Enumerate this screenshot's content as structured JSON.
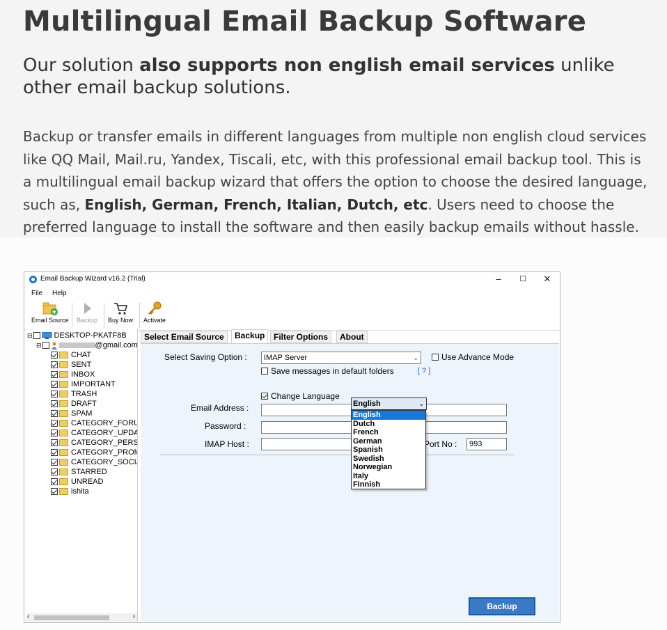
{
  "page": {
    "title": "Multilingual Email Backup Software",
    "subtitle_pre": "Our solution ",
    "subtitle_bold": "also supports non english email services",
    "subtitle_post": " unlike other email backup solutions.",
    "para_pre": "Backup or transfer emails in different languages from multiple non english cloud services like QQ Mail, Mail.ru, Yandex, Tiscali, etc, with this professional email backup tool. This is a multilingual email backup wizard that offers the option to choose the desired language, such as, ",
    "para_bold": "English, German, French, Italian, Dutch, etc",
    "para_post": ". Users need to choose the preferred language to install the software and then easily backup emails without hassle."
  },
  "window": {
    "title": "Email Backup Wizard v16.2 (Trial)",
    "controls": {
      "minimize": "–",
      "maximize": "☐",
      "close": "✕"
    },
    "menu": [
      "File",
      "Help"
    ],
    "toolbar": [
      "Email Source",
      "Backup",
      "Buy Now",
      "Activate"
    ],
    "tree": {
      "root": "DESKTOP-PKATF8B",
      "account": "@gmail.com",
      "folders": [
        "CHAT",
        "SENT",
        "INBOX",
        "IMPORTANT",
        "TRASH",
        "DRAFT",
        "SPAM",
        "CATEGORY_FORUMS",
        "CATEGORY_UPDATES",
        "CATEGORY_PERSONAL",
        "CATEGORY_PROMOTIONS",
        "CATEGORY_SOCIAL",
        "STARRED",
        "UNREAD",
        "ishita"
      ]
    },
    "tabs": [
      "Select Email Source",
      "Backup",
      "Filter Options",
      "About"
    ],
    "active_tab": "Backup",
    "form": {
      "saving_label": "Select Saving Option :",
      "saving_value": "IMAP Server",
      "advance_mode": "Use Advance Mode",
      "default_folders": "Save messages in default folders",
      "help_link": "[ ? ]",
      "change_language": "Change Language",
      "language_selected": "English",
      "languages": [
        "English",
        "Dutch",
        "French",
        "German",
        "Spanish",
        "Swedish",
        "Norwegian",
        "Italy",
        "Finnish"
      ],
      "email_label": "Email Address :",
      "password_label": "Password :",
      "imap_host_label": "IMAP Host :",
      "port_label": "Port No :",
      "port_value": "993",
      "backup_button": "Backup"
    }
  }
}
